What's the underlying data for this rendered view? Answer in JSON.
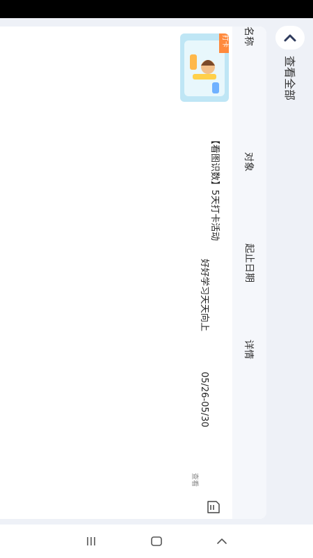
{
  "table": {
    "headers": {
      "name": "名称",
      "target": "对象",
      "date_range": "起止日期",
      "detail": "详情"
    },
    "rows": [
      {
        "thumb_badge": "打卡",
        "name": "【看图识数】5天打卡活动",
        "target": "好好学习天天向上",
        "date_range": "05/26-05/30",
        "detail_label": "查看"
      }
    ]
  },
  "view_all": {
    "label": "查看全部"
  },
  "icons": {
    "collapse": "chevron-up-icon",
    "detail": "document-icon",
    "nav_recent": "recent-apps-icon",
    "nav_home": "home-icon",
    "nav_back": "back-icon"
  },
  "colors": {
    "background": "#eef1f7",
    "header_strip": "#f5f7fb",
    "accent": "#2e3a5c",
    "badge": "#ff8a3d"
  }
}
